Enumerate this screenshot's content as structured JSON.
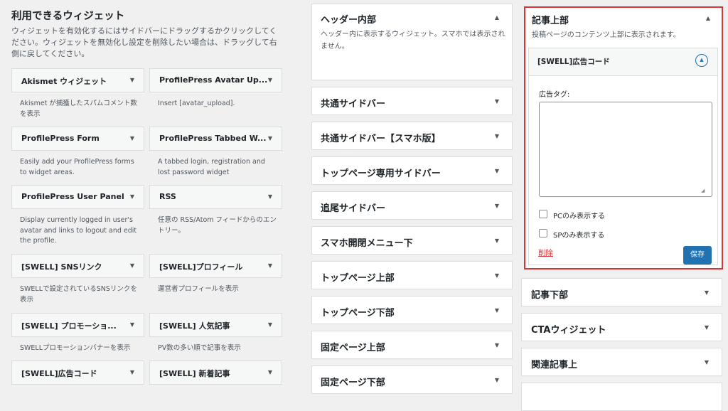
{
  "available": {
    "title": "利用できるウィジェット",
    "description": "ウィジェットを有効化するにはサイドバーにドラッグするかクリックしてください。ウィジェットを無効化し設定を削除したい場合は、ドラッグして右側に戻してください。",
    "widgets": [
      {
        "name": "Akismet ウィジェット",
        "desc": "Akismet が捕獲したスパムコメント数を表示"
      },
      {
        "name": "ProfilePress Avatar Up...",
        "desc": "Insert [avatar_upload]."
      },
      {
        "name": "ProfilePress Form",
        "desc": "Easily add your ProfilePress forms to widget areas."
      },
      {
        "name": "ProfilePress Tabbed W...",
        "desc": "A tabbed login, registration and lost password widget"
      },
      {
        "name": "ProfilePress User Panel",
        "desc": "Display currently logged in user's avatar and links to logout and edit the profile."
      },
      {
        "name": "RSS",
        "desc": "任意の RSS/Atom フィードからのエントリー。"
      },
      {
        "name": "[SWELL] SNSリンク",
        "desc": "SWELLで設定されているSNSリンクを表示"
      },
      {
        "name": "[SWELL]プロフィール",
        "desc": "運営者プロフィールを表示"
      },
      {
        "name": "[SWELL] プロモーショ...",
        "desc": "SWELLプロモーションバナーを表示"
      },
      {
        "name": "[SWELL] 人気記事",
        "desc": "PV数の多い順で記事を表示"
      },
      {
        "name": "[SWELL]広告コード",
        "desc": ""
      },
      {
        "name": "[SWELL] 新着記事",
        "desc": ""
      }
    ]
  },
  "sidebars": [
    {
      "title": "ヘッダー内部",
      "desc": "ヘッダー内に表示するウィジェット。スマホでは表示されません。",
      "expanded": true
    },
    {
      "title": "共通サイドバー"
    },
    {
      "title": "共通サイドバー【スマホ版】"
    },
    {
      "title": "トップページ専用サイドバー"
    },
    {
      "title": "追尾サイドバー"
    },
    {
      "title": "スマホ開閉メニュー下"
    },
    {
      "title": "トップページ上部"
    },
    {
      "title": "トップページ下部"
    },
    {
      "title": "固定ページ上部"
    },
    {
      "title": "固定ページ下部"
    }
  ],
  "article_top": {
    "title": "記事上部",
    "desc": "投稿ページのコンテンツ上部に表示されます。",
    "widget": {
      "title": "[SWELL]広告コード",
      "ad_tag_label": "広告タグ:",
      "ad_tag_value": "",
      "pc_only_label": "PCのみ表示する",
      "sp_only_label": "SPのみ表示する",
      "pc_only_checked": false,
      "sp_only_checked": false,
      "delete_label": "削除",
      "save_label": "保存"
    }
  },
  "right_sidebars": [
    {
      "title": "記事下部"
    },
    {
      "title": "CTAウィジェット"
    },
    {
      "title": "関連記事上"
    }
  ],
  "icons": {
    "collapse": "triangle-down-icon",
    "expand": "triangle-up-icon"
  },
  "colors": {
    "highlight_border": "#d63638",
    "primary_button": "#2271b1",
    "delete_link": "#d63638"
  }
}
